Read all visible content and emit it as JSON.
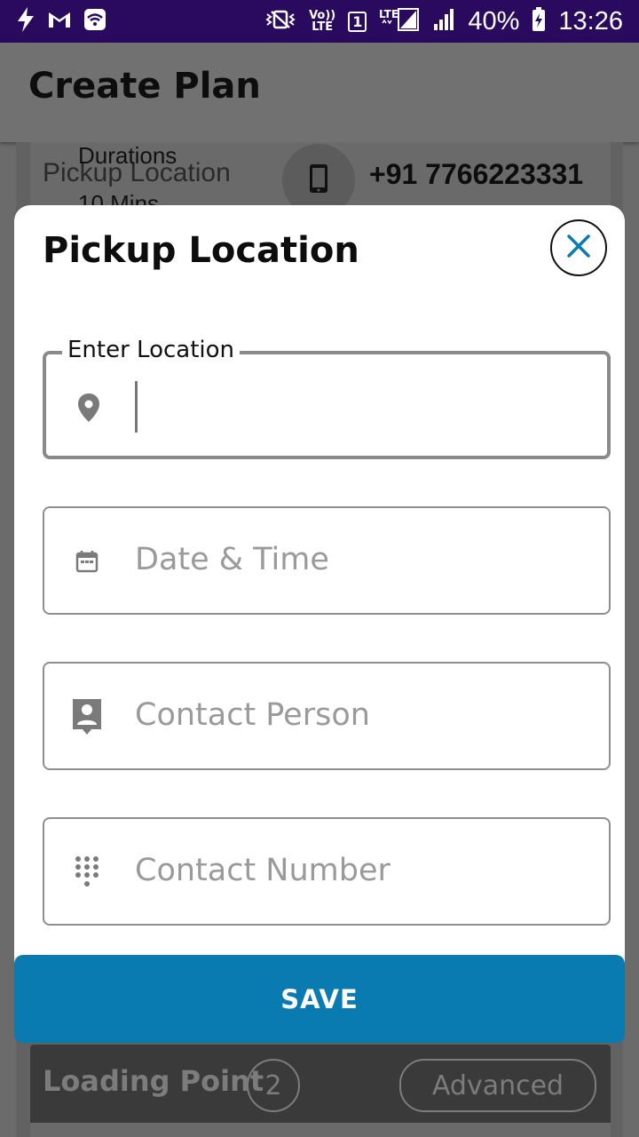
{
  "status_bar": {
    "battery": "40%",
    "time": "13:26",
    "sim_slot": "1",
    "network_top": "Vo))",
    "network_bottom": "LTE",
    "lte_label": "LTE"
  },
  "app_bar": {
    "title": "Create Plan"
  },
  "background": {
    "durations_label": "Durations",
    "pickup_label": "Pickup Location",
    "mins_value": "10 Mins",
    "phone_number": "+91 7766223331",
    "loading_label": "Loading Point",
    "loading_count": "2",
    "advanced_label": "Advanced"
  },
  "modal": {
    "title": "Pickup Location",
    "fields": {
      "location": {
        "legend": "Enter Location",
        "value": ""
      },
      "datetime": {
        "placeholder": "Date & Time"
      },
      "contact_person": {
        "placeholder": "Contact Person"
      },
      "contact_number": {
        "placeholder": "Contact Number"
      }
    },
    "save_label": "SAVE"
  },
  "colors": {
    "status_bar": "#2a0a5e",
    "accent": "#0a7bb0",
    "close_icon": "#0a7bb0"
  }
}
